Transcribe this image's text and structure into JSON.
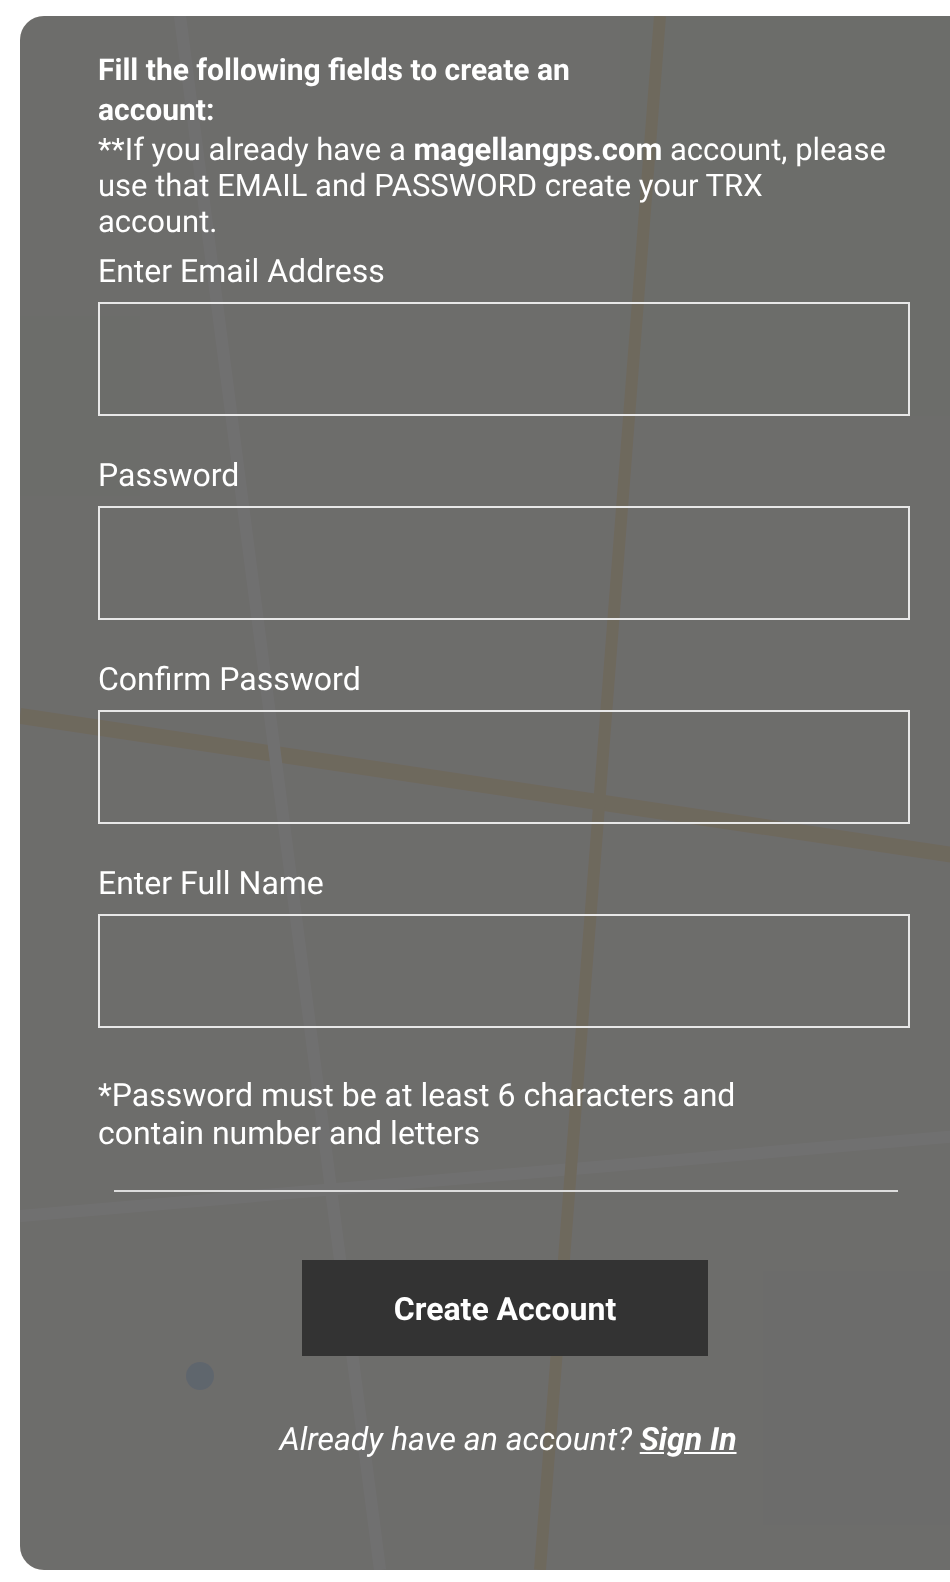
{
  "heading": "Fill the following fields to create an account:",
  "note": {
    "prefix": "**If you already have a ",
    "brand": "magellangps.com",
    "rest": " account, please use that EMAIL and PASSWORD create your TRX account."
  },
  "fields": [
    {
      "label": "Enter Email Address"
    },
    {
      "label": "Password"
    },
    {
      "label": "Confirm Password"
    },
    {
      "label": "Enter Full Name"
    }
  ],
  "password_hint": "*Password must be at least 6 characters and contain number and letters",
  "submit_button": "Create Account",
  "footer": {
    "question": "Already have an account?",
    "link": "Sign In"
  }
}
